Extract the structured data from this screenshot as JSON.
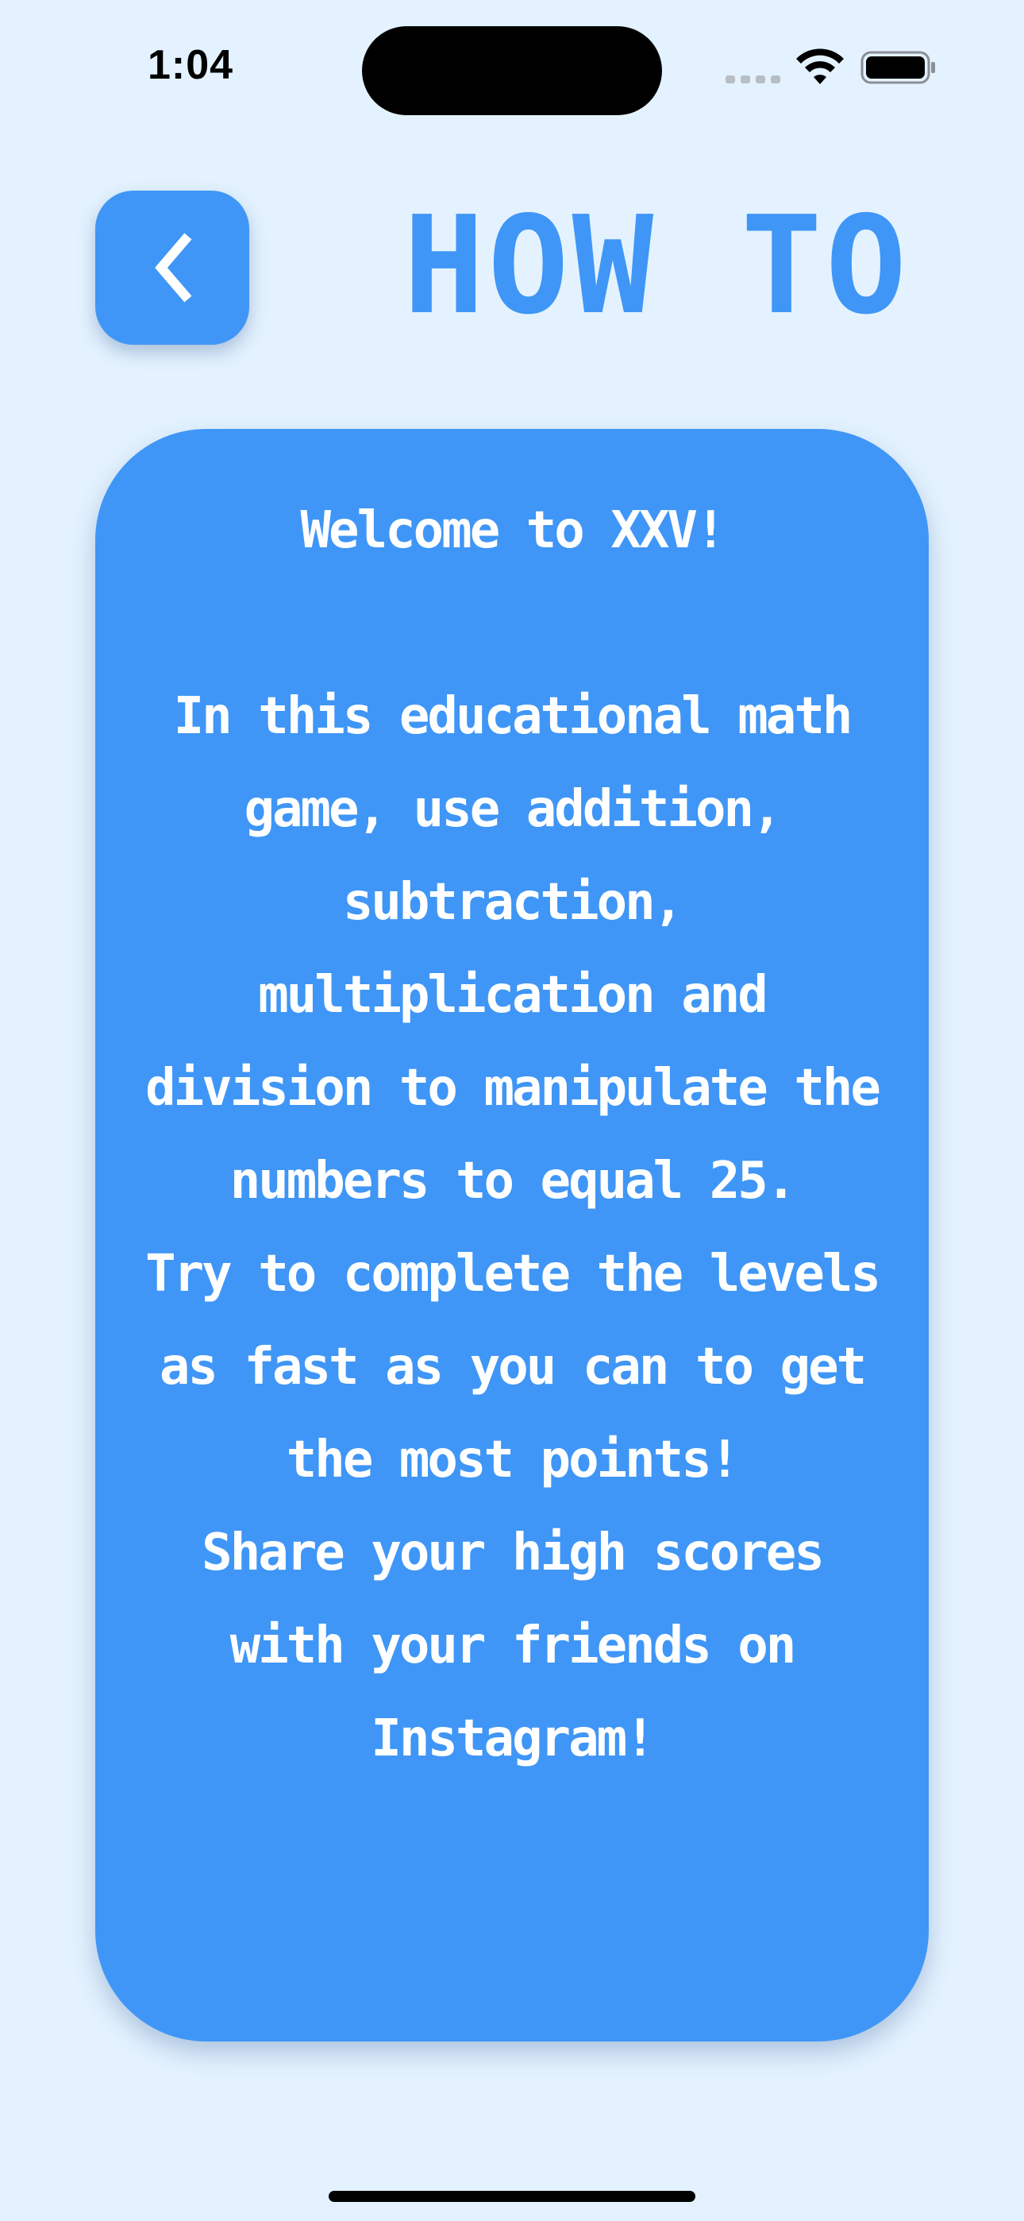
{
  "status_bar": {
    "time": "1:04"
  },
  "header": {
    "back_icon": "chevron-left-icon",
    "title": "HOW TO"
  },
  "card": {
    "text": "Welcome to XXV!\n\nIn this educational math game, use addition, subtraction, multiplication and division to manipulate the numbers to equal 25.\nTry to complete the levels as fast as you can to get the most points!\nShare your high scores with your friends on Instagram!"
  },
  "colors": {
    "background": "#E3F2FE",
    "accent": "#3F96F6",
    "card_text": "#FFFFFF"
  }
}
